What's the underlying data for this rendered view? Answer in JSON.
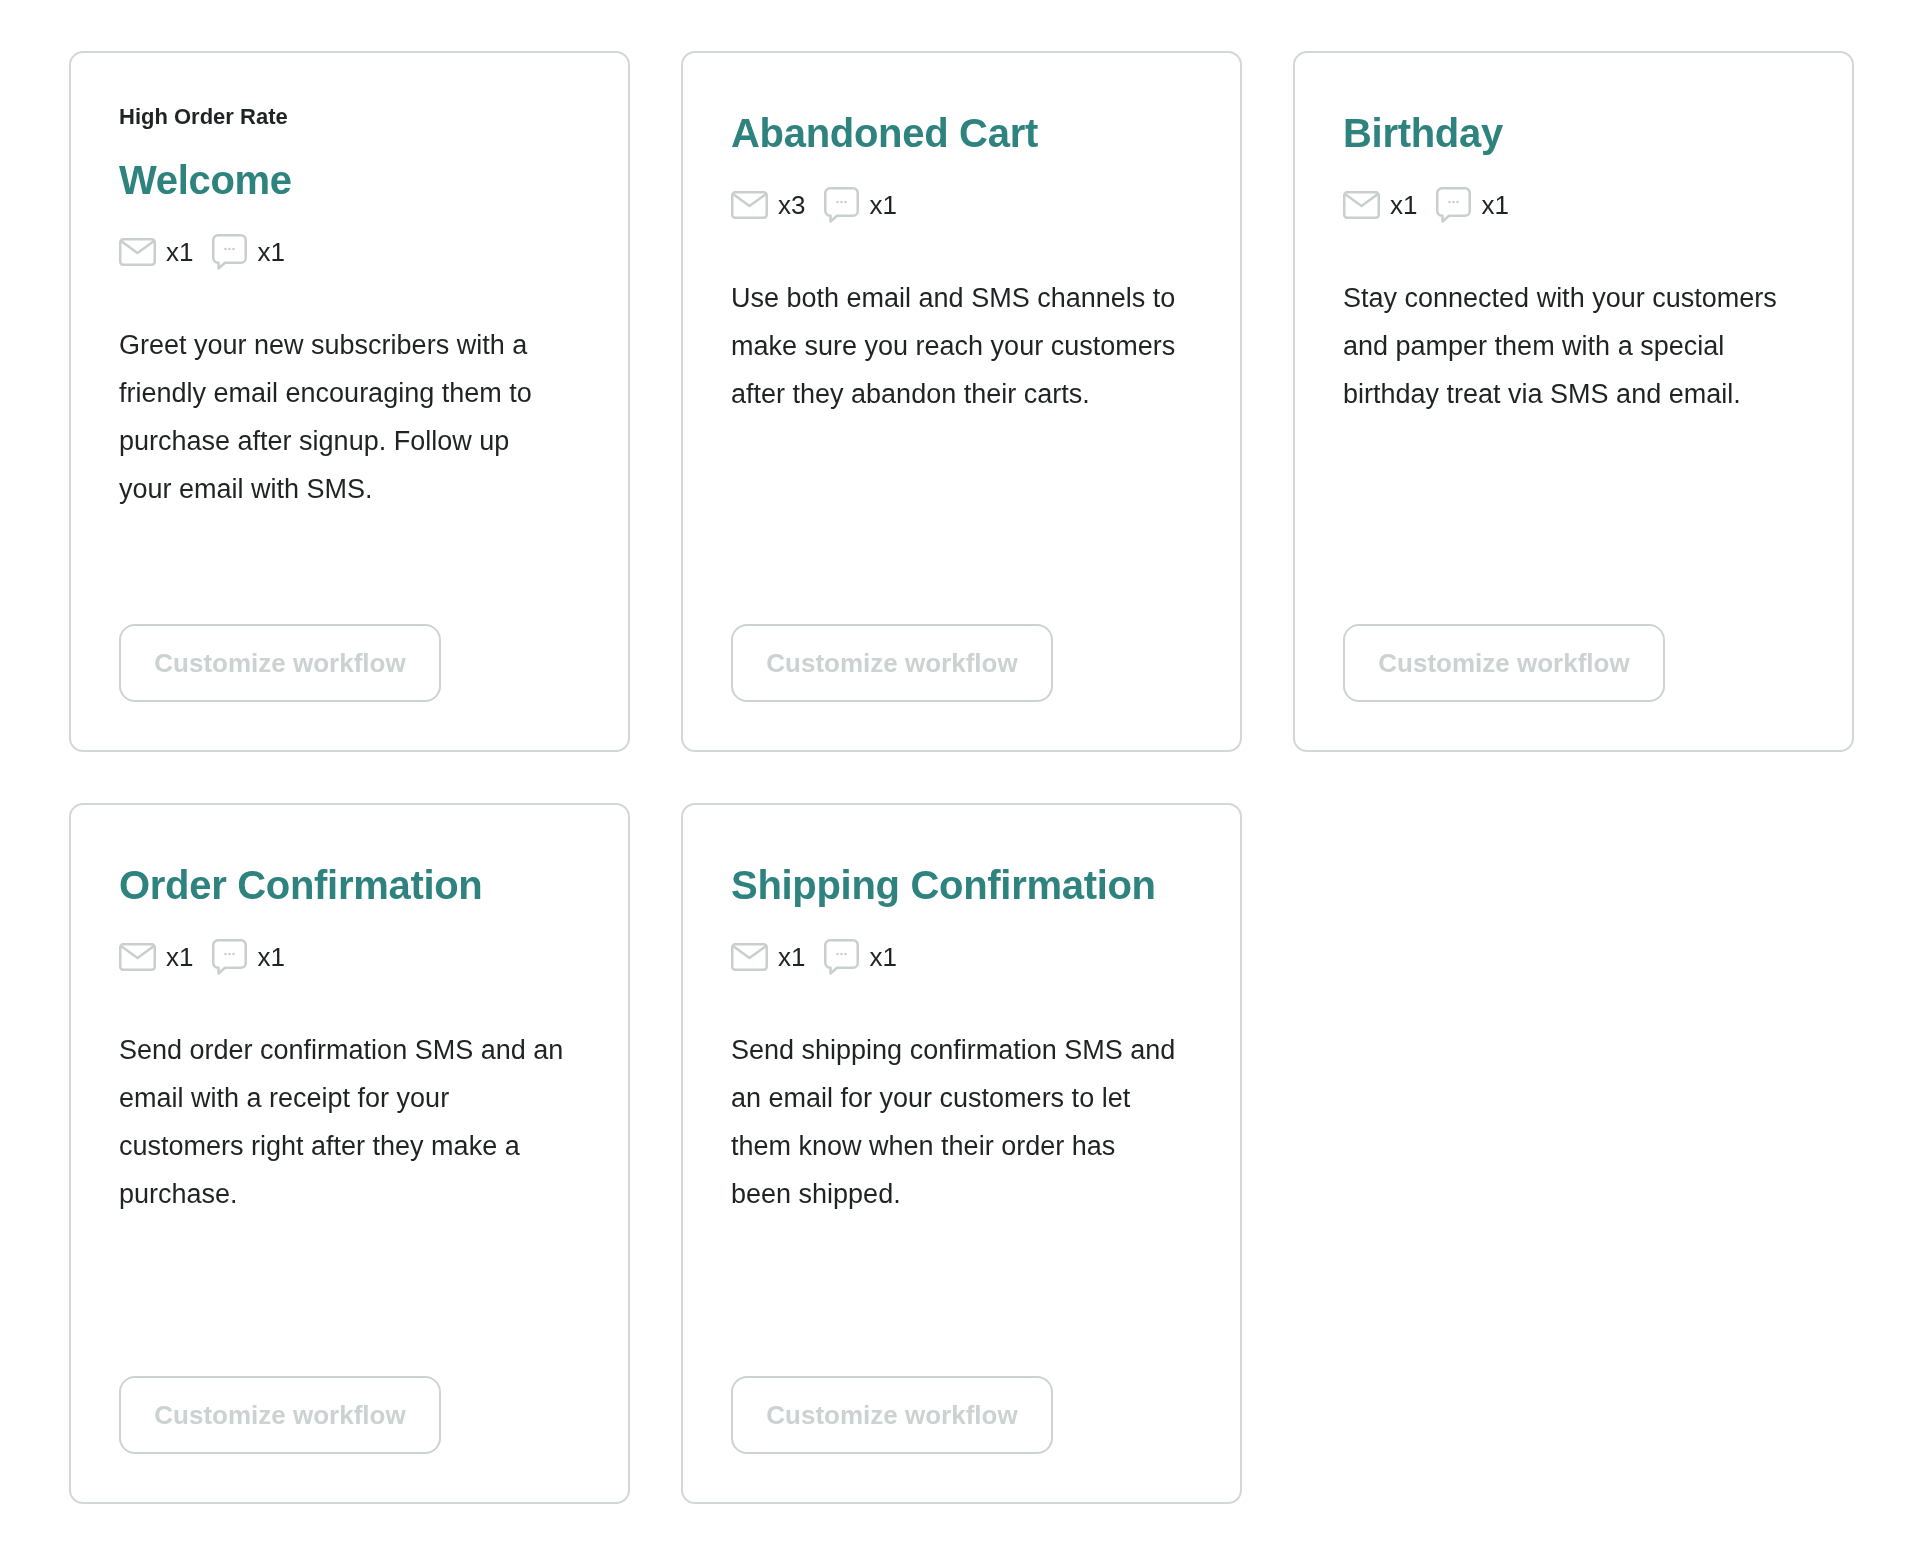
{
  "cards": [
    {
      "label": "High Order Rate",
      "title": "Welcome",
      "channels": [
        {
          "kind": "email",
          "count": "x1"
        },
        {
          "kind": "sms",
          "count": "x1"
        }
      ],
      "description": "Greet your new subscribers with a friendly email encouraging them to purchase after signup. Follow up your email with SMS.",
      "button": {
        "label": "Customize workflow",
        "disabled": true
      }
    },
    {
      "title": "Abandoned Cart",
      "channels": [
        {
          "kind": "email",
          "count": "x3"
        },
        {
          "kind": "sms",
          "count": "x1"
        }
      ],
      "description": "Use both email and SMS channels to make sure you reach your customers after they abandon their carts.",
      "button": {
        "label": "Customize workflow",
        "disabled": true
      }
    },
    {
      "title": "Birthday",
      "channels": [
        {
          "kind": "email",
          "count": "x1"
        },
        {
          "kind": "sms",
          "count": "x1"
        }
      ],
      "description": "Stay connected with your customers and pamper them with a special birthday treat via SMS and email.",
      "button": {
        "label": "Customize workflow",
        "disabled": true
      }
    },
    {
      "title": "Order Confirmation",
      "channels": [
        {
          "kind": "email",
          "count": "x1"
        },
        {
          "kind": "sms",
          "count": "x1"
        }
      ],
      "description": "Send order confirmation SMS and an email with a receipt for your customers right after they make a purchase.",
      "button": {
        "label": "Customize workflow",
        "disabled": true
      }
    },
    {
      "title": "Shipping Confirmation",
      "channels": [
        {
          "kind": "email",
          "count": "x1"
        },
        {
          "kind": "sms",
          "count": "x1"
        }
      ],
      "description": "Send shipping confirmation SMS and an email for your customers to let them know when their order has been shipped.",
      "button": {
        "label": "Customize workflow",
        "disabled": true
      }
    }
  ]
}
